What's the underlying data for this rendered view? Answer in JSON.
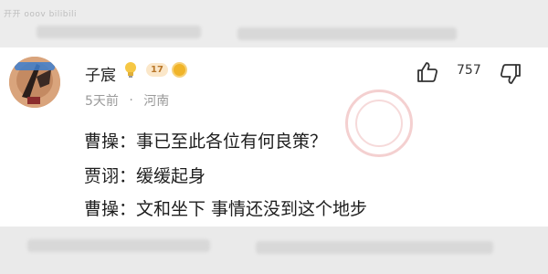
{
  "watermark": "开开 ooov bilibili",
  "comment": {
    "username": "子宸",
    "level": "17",
    "time": "5天前",
    "separator": "·",
    "location": "河南",
    "likes": "757",
    "lines": [
      "曹操：事已至此各位有何良策？",
      "贾诩：缓缓起身",
      "曹操：文和坐下 事情还没到这个地步"
    ]
  },
  "icons": {
    "like": "thumb-up-icon",
    "dislike": "thumb-down-icon",
    "bulb": "lightbulb-icon",
    "medal": "medal-icon"
  },
  "colors": {
    "background": "#e9e9e9",
    "card": "#ffffff",
    "text": "#1e1e1e",
    "meta": "#9a9a9a",
    "level_badge": "#fbe7c9"
  }
}
